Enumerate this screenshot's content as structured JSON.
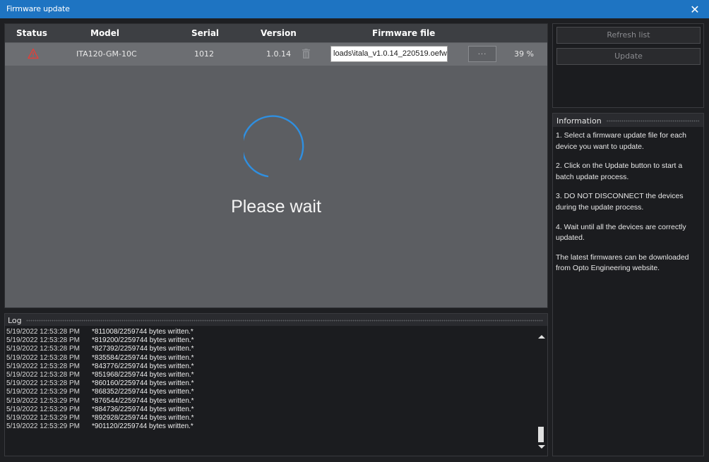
{
  "window": {
    "title": "Firmware update",
    "close_glyph": "✕"
  },
  "grid": {
    "columns": [
      "Status",
      "Model",
      "Serial",
      "Version",
      "Firmware file"
    ],
    "row": {
      "status_icon": "warning-triangle-icon",
      "model": "ITA120-GM-10C",
      "serial": "1012",
      "version": "1.0.14",
      "firmware_file": "loads\\itala_v1.0.14_220519.oefw",
      "browse_label": "...",
      "progress": "39 %"
    }
  },
  "overlay": {
    "message": "Please wait"
  },
  "buttons": {
    "refresh": "Refresh list",
    "update": "Update"
  },
  "info": {
    "title": "Information",
    "paragraphs": [
      "1. Select a firmware update file for each device you want to update.",
      "2. Click on the Update button to start a batch update process.",
      "3. DO NOT DISCONNECT the devices during the update process.",
      "4. Wait until all the devices are correctly updated.",
      "The latest firmwares can be downloaded from Opto Engineering website."
    ]
  },
  "log": {
    "title": "Log",
    "lines": [
      {
        "ts": "5/19/2022 12:53:28 PM",
        "msg": "*811008/2259744 bytes written.*"
      },
      {
        "ts": "5/19/2022 12:53:28 PM",
        "msg": "*819200/2259744 bytes written.*"
      },
      {
        "ts": "5/19/2022 12:53:28 PM",
        "msg": "*827392/2259744 bytes written.*"
      },
      {
        "ts": "5/19/2022 12:53:28 PM",
        "msg": "*835584/2259744 bytes written.*"
      },
      {
        "ts": "5/19/2022 12:53:28 PM",
        "msg": "*843776/2259744 bytes written.*"
      },
      {
        "ts": "5/19/2022 12:53:28 PM",
        "msg": "*851968/2259744 bytes written.*"
      },
      {
        "ts": "5/19/2022 12:53:28 PM",
        "msg": "*860160/2259744 bytes written.*"
      },
      {
        "ts": "5/19/2022 12:53:29 PM",
        "msg": "*868352/2259744 bytes written.*"
      },
      {
        "ts": "5/19/2022 12:53:29 PM",
        "msg": "*876544/2259744 bytes written.*"
      },
      {
        "ts": "5/19/2022 12:53:29 PM",
        "msg": "*884736/2259744 bytes written.*"
      },
      {
        "ts": "5/19/2022 12:53:29 PM",
        "msg": "*892928/2259744 bytes written.*"
      },
      {
        "ts": "5/19/2022 12:53:29 PM",
        "msg": "*901120/2259744 bytes written.*"
      }
    ]
  },
  "colors": {
    "titlebar": "#1e74c2",
    "spinner": "#2f8fe0",
    "warning": "#e0403a"
  }
}
